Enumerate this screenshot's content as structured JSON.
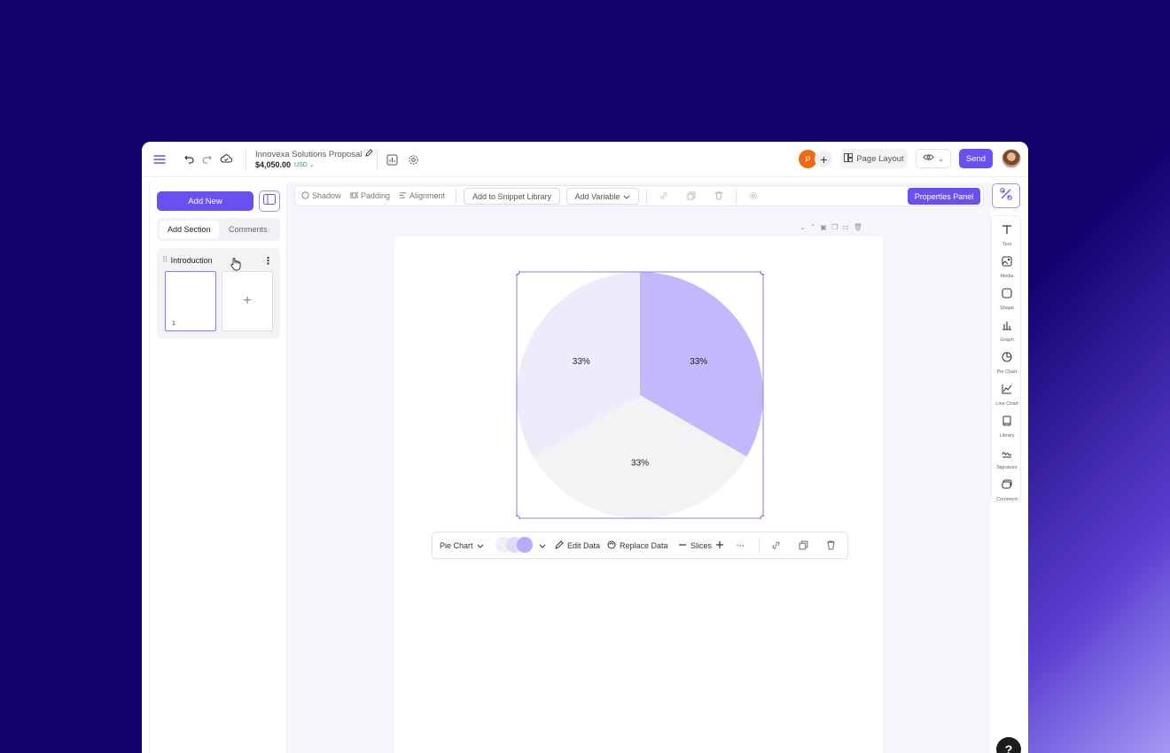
{
  "header": {
    "doc_title": "Innovexa Solutions Proposal",
    "price": "$4,050.00",
    "currency": "USD",
    "avatar_initial": "P",
    "page_layout_label": "Page Layout",
    "send_label": "Send"
  },
  "sidebar": {
    "add_new_label": "Add New",
    "tabs": [
      {
        "label": "Add Section",
        "active": true
      },
      {
        "label": "Comments",
        "active": false
      }
    ],
    "section": {
      "title": "Introduction",
      "pages": [
        "1"
      ]
    }
  },
  "toolbar": {
    "shadow": "Shadow",
    "padding": "Padding",
    "alignment": "Alignment",
    "snippet": "Add to Snippet Library",
    "variable": "Add Variable",
    "properties": "Properties Panel"
  },
  "chart_toolbar": {
    "type_label": "Pie Chart",
    "edit_data": "Edit Data",
    "replace_data": "Replace Data",
    "slices": "Slices",
    "more": "···"
  },
  "right_rail": [
    {
      "label": "Text",
      "icon": "text-icon"
    },
    {
      "label": "Media",
      "icon": "media-icon"
    },
    {
      "label": "Shape",
      "icon": "shape-icon"
    },
    {
      "label": "Graph",
      "icon": "graph-icon"
    },
    {
      "label": "Pie Chart",
      "icon": "pie-chart-icon"
    },
    {
      "label": "Line Chart",
      "icon": "line-chart-icon"
    },
    {
      "label": "Library",
      "icon": "library-icon"
    },
    {
      "label": "Signature",
      "icon": "signature-icon"
    },
    {
      "label": "Comment",
      "icon": "comment-icon"
    }
  ],
  "help_label": "?",
  "colors": {
    "accent": "#6b4ff0",
    "background": "#13006d"
  },
  "chart_data": {
    "type": "pie",
    "categories": [
      "",
      "",
      ""
    ],
    "values": [
      33.33,
      33.33,
      33.34
    ],
    "labels": [
      "33%",
      "33%",
      "33%"
    ],
    "colors": [
      "#c3b8fb",
      "#f3f3f5",
      "#eeebfd"
    ]
  }
}
